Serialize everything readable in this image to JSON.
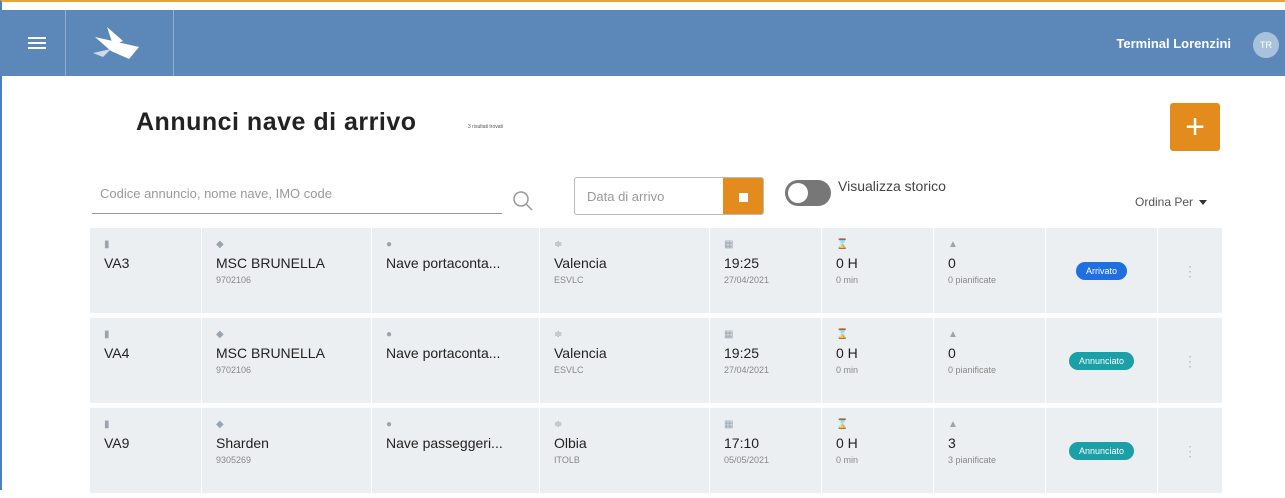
{
  "header": {
    "terminal": "Terminal Lorenzini",
    "avatar": "TR"
  },
  "page": {
    "title": "Annunci nave di arrivo",
    "results": "3 risultati trovati"
  },
  "search": {
    "placeholder": "Codice annuncio, nome nave, IMO code"
  },
  "date": {
    "placeholder": "Data di arrivo"
  },
  "toggle": {
    "label": "Visualizza storico"
  },
  "sort": {
    "label": "Ordina Per"
  },
  "colors": {
    "arrivato": "#1f6fe0",
    "annunciato": "#1ba0a8",
    "accent": "#e48b1e",
    "header": "#5b88b9"
  },
  "rows": [
    {
      "code": "VA3",
      "ship": "MSC BRUNELLA",
      "imo": "9702106",
      "type": "Nave portaconta...",
      "port": "Valencia",
      "port_code": "ESVLC",
      "time": "19:25",
      "date": "27/04/2021",
      "duration": "0 H",
      "duration_min": "0 min",
      "count": "0",
      "planned": "0 pianificate",
      "status": "Arrivato",
      "status_color": "#1f6fe0"
    },
    {
      "code": "VA4",
      "ship": "MSC BRUNELLA",
      "imo": "9702106",
      "type": "Nave portaconta...",
      "port": "Valencia",
      "port_code": "ESVLC",
      "time": "19:25",
      "date": "27/04/2021",
      "duration": "0 H",
      "duration_min": "0 min",
      "count": "0",
      "planned": "0 pianificate",
      "status": "Annunciato",
      "status_color": "#1ba0a8"
    },
    {
      "code": "VA9",
      "ship": "Sharden",
      "imo": "9305269",
      "type": "Nave passeggeri...",
      "port": "Olbia",
      "port_code": "ITOLB",
      "time": "17:10",
      "date": "05/05/2021",
      "duration": "0 H",
      "duration_min": "0 min",
      "count": "3",
      "planned": "3 pianificate",
      "status": "Annunciato",
      "status_color": "#1ba0a8"
    }
  ]
}
